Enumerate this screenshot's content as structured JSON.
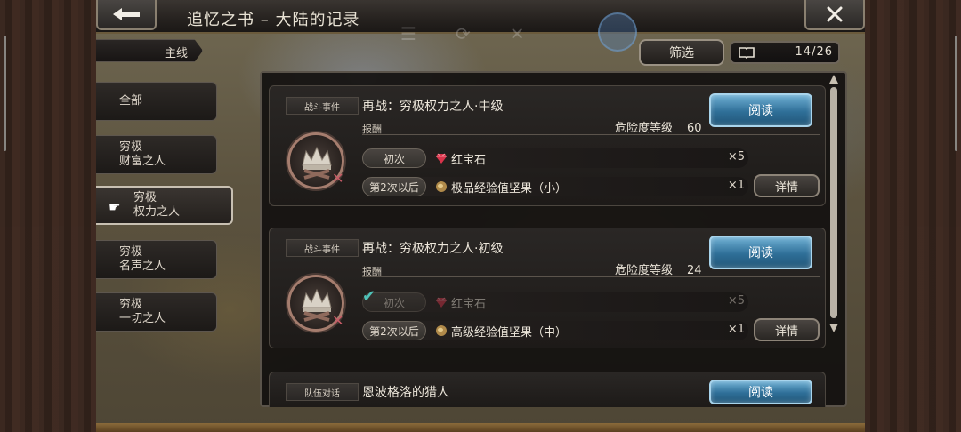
{
  "header": {
    "title": "追忆之书 – 大陆的记录",
    "back_label": "back",
    "close_label": "close"
  },
  "mainline": {
    "label": "主线"
  },
  "sidebar": {
    "items": [
      {
        "line1": "全部",
        "line2": ""
      },
      {
        "line1": "穷极",
        "line2": "财富之人"
      },
      {
        "line1": "穷极",
        "line2": "权力之人",
        "active": true
      },
      {
        "line1": "穷极",
        "line2": "名声之人"
      },
      {
        "line1": "穷极",
        "line2": "一切之人"
      }
    ]
  },
  "toolbar": {
    "filter_label": "筛选",
    "counter": "14/26"
  },
  "cards": [
    {
      "tag": "战斗事件",
      "title": "再战：穷极权力之人·中级",
      "read_label": "阅读",
      "reward_label": "报酬",
      "danger_label": "危险度等级",
      "danger_value": "60",
      "rewards": [
        {
          "pill": "初次",
          "name": "红宝石",
          "qty": "×5",
          "icon": "ruby-icon",
          "claimed": false
        },
        {
          "pill": "第2次以后",
          "name": "极品经验值坚果（小）",
          "qty": "×1",
          "icon": "nut-icon",
          "claimed": false
        }
      ],
      "detail_label": "详情"
    },
    {
      "tag": "战斗事件",
      "title": "再战：穷极权力之人·初级",
      "read_label": "阅读",
      "reward_label": "报酬",
      "danger_label": "危险度等级",
      "danger_value": "24",
      "rewards": [
        {
          "pill": "初次",
          "name": "红宝石",
          "qty": "×5",
          "icon": "ruby-icon",
          "claimed": true
        },
        {
          "pill": "第2次以后",
          "name": "高级经验值坚果（中）",
          "qty": "×1",
          "icon": "nut-icon",
          "claimed": false
        }
      ],
      "detail_label": "详情"
    },
    {
      "tag": "队伍对话",
      "title": "恩波格洛的猎人",
      "read_label": "阅读"
    }
  ],
  "colors": {
    "accent_blue": "#2f6f98",
    "ruby": "#d9334a",
    "check": "#4fc2b8"
  }
}
